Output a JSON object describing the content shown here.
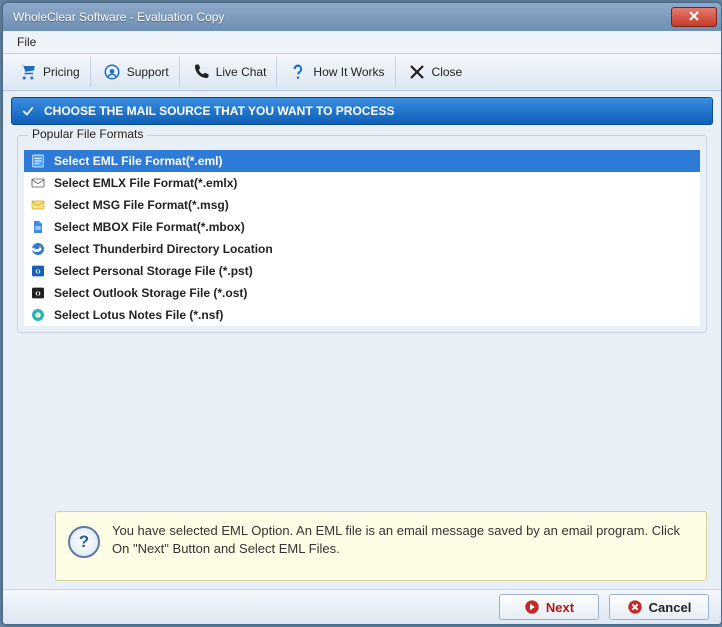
{
  "window": {
    "title": "WholeClear Software - Evaluation Copy"
  },
  "menubar": {
    "file": "File"
  },
  "toolbar": {
    "pricing": "Pricing",
    "support": "Support",
    "livechat": "Live Chat",
    "howitworks": "How It Works",
    "close": "Close"
  },
  "header": {
    "title": "CHOOSE THE MAIL SOURCE THAT YOU WANT TO PROCESS"
  },
  "group": {
    "title": "Popular File Formats"
  },
  "options": [
    {
      "label": "Select EML File Format(*.eml)",
      "selected": true
    },
    {
      "label": "Select EMLX File Format(*.emlx)",
      "selected": false
    },
    {
      "label": "Select MSG File Format(*.msg)",
      "selected": false
    },
    {
      "label": "Select MBOX File Format(*.mbox)",
      "selected": false
    },
    {
      "label": "Select Thunderbird Directory Location",
      "selected": false
    },
    {
      "label": "Select Personal Storage File (*.pst)",
      "selected": false
    },
    {
      "label": "Select Outlook Storage File (*.ost)",
      "selected": false
    },
    {
      "label": "Select Lotus Notes File (*.nsf)",
      "selected": false
    }
  ],
  "info": {
    "text": "You have selected EML Option. An EML file is an email message saved by an email program. Click On \"Next\" Button and Select EML Files."
  },
  "footer": {
    "next": "Next",
    "cancel": "Cancel"
  },
  "colors": {
    "accent": "#2d7bd6"
  }
}
